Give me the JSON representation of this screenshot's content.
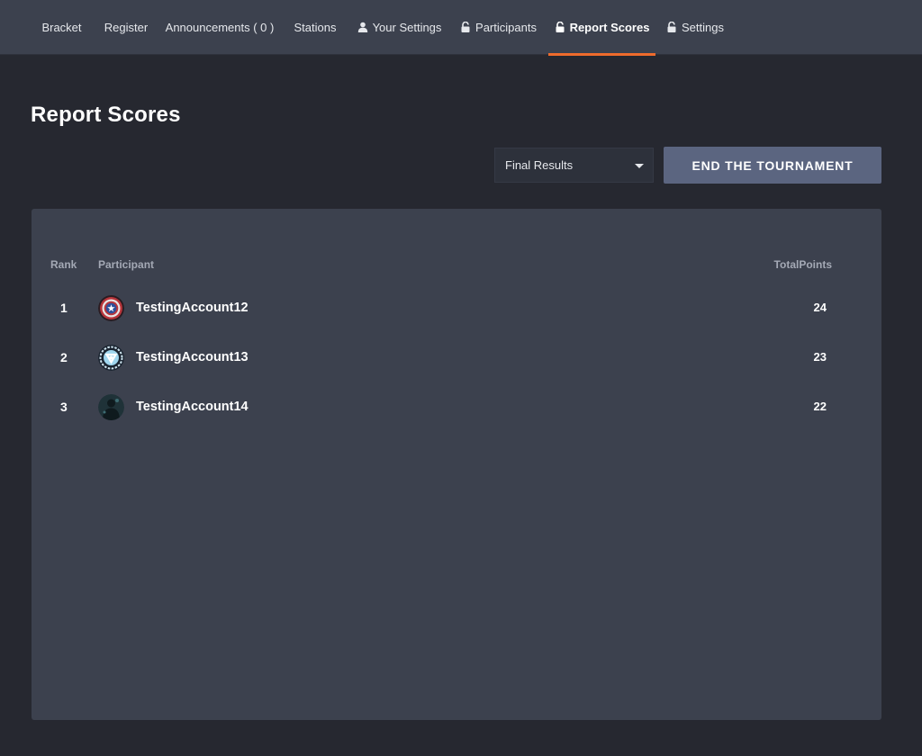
{
  "nav": {
    "tabs": [
      {
        "label": "Bracket",
        "icon": "",
        "active": false
      },
      {
        "label": "Register",
        "icon": "",
        "active": false
      },
      {
        "label": "Announcements ( 0 )",
        "icon": "",
        "active": false
      },
      {
        "label": "Stations",
        "icon": "",
        "active": false
      },
      {
        "label": "Your Settings",
        "icon": "user-icon",
        "active": false
      },
      {
        "label": "Participants",
        "icon": "unlock-icon",
        "active": false
      },
      {
        "label": "Report Scores",
        "icon": "unlock-icon",
        "active": true
      },
      {
        "label": "Settings",
        "icon": "unlock-icon",
        "active": false
      }
    ],
    "accent_color": "#ef6b2c"
  },
  "page": {
    "title": "Report Scores"
  },
  "controls": {
    "results_select": {
      "selected": "Final Results"
    },
    "end_button_label": "END THE TOURNAMENT"
  },
  "results": {
    "columns": {
      "rank": "Rank",
      "participant": "Participant",
      "points": "TotalPoints"
    },
    "rows": [
      {
        "rank": "1",
        "participant": "TestingAccount12",
        "points": "24",
        "avatar": "shield-avatar"
      },
      {
        "rank": "2",
        "participant": "TestingAccount13",
        "points": "23",
        "avatar": "arc-reactor-avatar"
      },
      {
        "rank": "3",
        "participant": "TestingAccount14",
        "points": "22",
        "avatar": "dark-figure-avatar"
      }
    ]
  }
}
